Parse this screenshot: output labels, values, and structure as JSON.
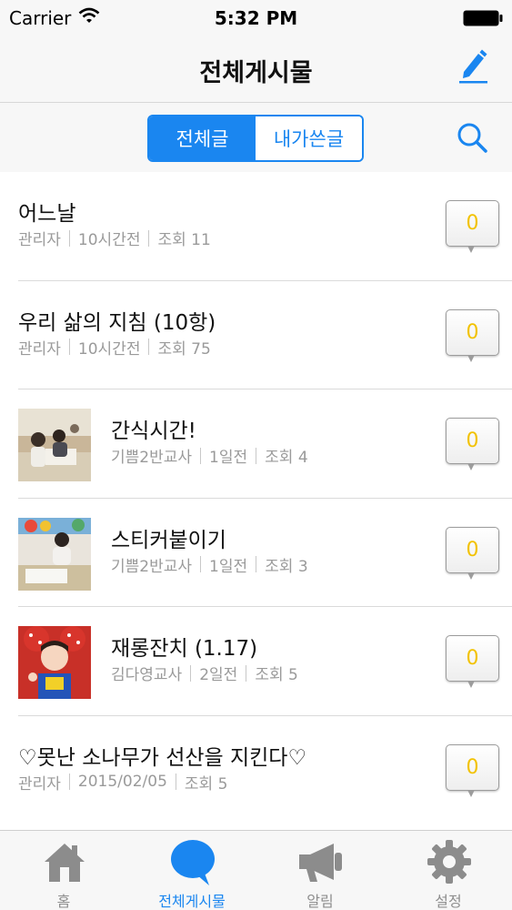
{
  "status_bar": {
    "carrier": "Carrier",
    "time": "5:32 PM"
  },
  "nav": {
    "title": "전체게시물",
    "edit_icon": "pencil-icon"
  },
  "segments": {
    "all": "전체글",
    "mine": "내가쓴글",
    "selected": "all"
  },
  "search_icon": "search-icon",
  "posts": [
    {
      "title": "어느날",
      "author": "관리자",
      "time": "10시간전",
      "views": "조회 11",
      "comments": "0",
      "has_thumb": false
    },
    {
      "title": "우리 삶의 지침 (10항)",
      "author": "관리자",
      "time": "10시간전",
      "views": "조회 75",
      "comments": "0",
      "has_thumb": false
    },
    {
      "title": "간식시간!",
      "author": "기쁨2반교사",
      "time": "1일전",
      "views": "조회 4",
      "comments": "0",
      "has_thumb": true
    },
    {
      "title": "스티커붙이기",
      "author": "기쁨2반교사",
      "time": "1일전",
      "views": "조회 3",
      "comments": "0",
      "has_thumb": true
    },
    {
      "title": "재롱잔치 (1.17)",
      "author": "김다영교사",
      "time": "2일전",
      "views": "조회 5",
      "comments": "0",
      "has_thumb": true
    },
    {
      "title": "♡못난 소나무가 선산을 지킨다♡",
      "author": "관리자",
      "time": "2015/02/05",
      "views": "조회 5",
      "comments": "0",
      "has_thumb": false
    }
  ],
  "tabs": [
    {
      "label": "홈",
      "icon": "home-icon"
    },
    {
      "label": "전체게시물",
      "icon": "speech-bubble-icon"
    },
    {
      "label": "알림",
      "icon": "megaphone-icon"
    },
    {
      "label": "설정",
      "icon": "gear-icon"
    }
  ],
  "colors": {
    "accent": "#1a86f0",
    "count": "#f2c200",
    "meta": "#9a9a9a"
  }
}
